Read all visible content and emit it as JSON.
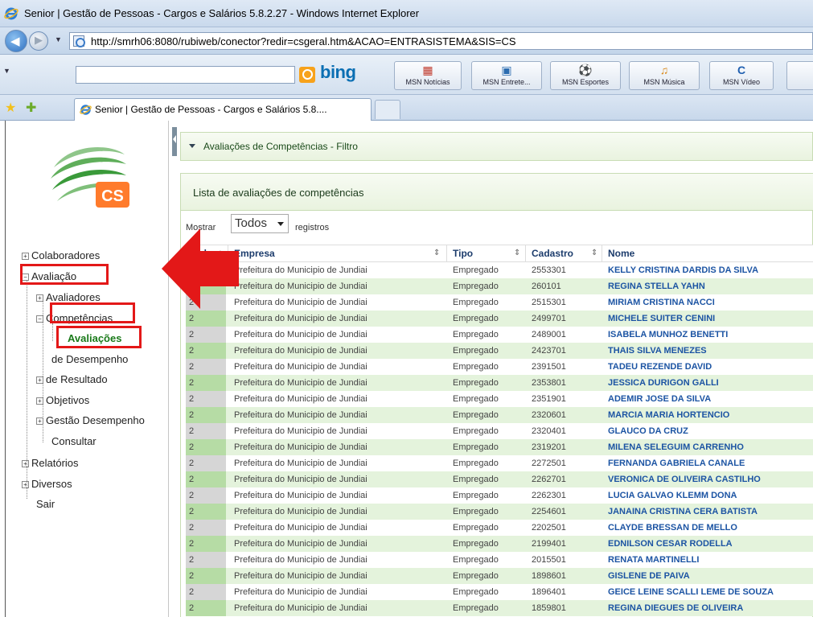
{
  "window": {
    "title": "Senior | Gestão de Pessoas - Cargos e Salários 5.8.2.27 - Windows Internet Explorer",
    "url": "http://smrh06:8080/rubiweb/conector?redir=csgeral.htm&ACAO=ENTRASISTEMA&SIS=CS",
    "search_logo": "bing",
    "links": [
      {
        "label": "MSN Notícias",
        "icon": "news-icon",
        "color": "#c0392b"
      },
      {
        "label": "MSN Entrete...",
        "icon": "entertainment-icon",
        "color": "#2b6cb0"
      },
      {
        "label": "MSN Esportes",
        "icon": "sports-icon",
        "color": "#2e8b57"
      },
      {
        "label": "MSN Música",
        "icon": "music-icon",
        "color": "#d98a1c"
      },
      {
        "label": "MSN Vídeo",
        "icon": "video-icon",
        "color": "#1f5fb0"
      }
    ],
    "tab_title": "Senior | Gestão de Pessoas - Cargos e Salários 5.8...."
  },
  "sidebar": {
    "logo_text": "CS",
    "tree": {
      "colaboradores": "Colaboradores",
      "avaliacao": "Avaliação",
      "avaliadores": "Avaliadores",
      "competencias": "Competências",
      "avaliacoes": "Avaliações",
      "desempenho": "de Desempenho",
      "resultado": "de Resultado",
      "objetivos": "Objetivos",
      "gestao_desempenho": "Gestão Desempenho",
      "consultar": "Consultar",
      "relatorios": "Relatórios",
      "diversos": "Diversos",
      "sair": "Sair"
    },
    "highlight_color": "#e31818"
  },
  "filter_panel": {
    "title": "Avaliações de Competências - Filtro"
  },
  "list": {
    "title": "Lista de avaliações de competências",
    "show_label": "Mostrar",
    "show_value": "Todos",
    "show_suffix": "registros",
    "columns": {
      "ciclo": "Ciclo",
      "empresa": "Empresa",
      "tipo": "Tipo",
      "cadastro": "Cadastro",
      "nome": "Nome"
    },
    "rows": [
      {
        "ciclo": "2",
        "empresa": "Prefeitura do Municipio de Jundiai",
        "tipo": "Empregado",
        "cadastro": "2553301",
        "nome": "KELLY CRISTINA DARDIS DA SILVA"
      },
      {
        "ciclo": "2",
        "empresa": "Prefeitura do Municipio de Jundiai",
        "tipo": "Empregado",
        "cadastro": "260101",
        "nome": "REGINA STELLA YAHN"
      },
      {
        "ciclo": "2",
        "empresa": "Prefeitura do Municipio de Jundiai",
        "tipo": "Empregado",
        "cadastro": "2515301",
        "nome": "MIRIAM CRISTINA NACCI"
      },
      {
        "ciclo": "2",
        "empresa": "Prefeitura do Municipio de Jundiai",
        "tipo": "Empregado",
        "cadastro": "2499701",
        "nome": "MICHELE SUITER CENINI"
      },
      {
        "ciclo": "2",
        "empresa": "Prefeitura do Municipio de Jundiai",
        "tipo": "Empregado",
        "cadastro": "2489001",
        "nome": "ISABELA MUNHOZ BENETTI"
      },
      {
        "ciclo": "2",
        "empresa": "Prefeitura do Municipio de Jundiai",
        "tipo": "Empregado",
        "cadastro": "2423701",
        "nome": "THAIS SILVA MENEZES"
      },
      {
        "ciclo": "2",
        "empresa": "Prefeitura do Municipio de Jundiai",
        "tipo": "Empregado",
        "cadastro": "2391501",
        "nome": "TADEU REZENDE DAVID"
      },
      {
        "ciclo": "2",
        "empresa": "Prefeitura do Municipio de Jundiai",
        "tipo": "Empregado",
        "cadastro": "2353801",
        "nome": "JESSICA DURIGON GALLI"
      },
      {
        "ciclo": "2",
        "empresa": "Prefeitura do Municipio de Jundiai",
        "tipo": "Empregado",
        "cadastro": "2351901",
        "nome": "ADEMIR JOSE DA SILVA"
      },
      {
        "ciclo": "2",
        "empresa": "Prefeitura do Municipio de Jundiai",
        "tipo": "Empregado",
        "cadastro": "2320601",
        "nome": "MARCIA MARIA HORTENCIO"
      },
      {
        "ciclo": "2",
        "empresa": "Prefeitura do Municipio de Jundiai",
        "tipo": "Empregado",
        "cadastro": "2320401",
        "nome": "GLAUCO DA CRUZ"
      },
      {
        "ciclo": "2",
        "empresa": "Prefeitura do Municipio de Jundiai",
        "tipo": "Empregado",
        "cadastro": "2319201",
        "nome": "MILENA SELEGUIM CARRENHO"
      },
      {
        "ciclo": "2",
        "empresa": "Prefeitura do Municipio de Jundiai",
        "tipo": "Empregado",
        "cadastro": "2272501",
        "nome": "FERNANDA GABRIELA CANALE"
      },
      {
        "ciclo": "2",
        "empresa": "Prefeitura do Municipio de Jundiai",
        "tipo": "Empregado",
        "cadastro": "2262701",
        "nome": "VERONICA DE OLIVEIRA CASTILHO"
      },
      {
        "ciclo": "2",
        "empresa": "Prefeitura do Municipio de Jundiai",
        "tipo": "Empregado",
        "cadastro": "2262301",
        "nome": "LUCIA GALVAO KLEMM DONA"
      },
      {
        "ciclo": "2",
        "empresa": "Prefeitura do Municipio de Jundiai",
        "tipo": "Empregado",
        "cadastro": "2254601",
        "nome": "JANAINA CRISTINA CERA BATISTA"
      },
      {
        "ciclo": "2",
        "empresa": "Prefeitura do Municipio de Jundiai",
        "tipo": "Empregado",
        "cadastro": "2202501",
        "nome": "CLAYDE BRESSAN DE MELLO"
      },
      {
        "ciclo": "2",
        "empresa": "Prefeitura do Municipio de Jundiai",
        "tipo": "Empregado",
        "cadastro": "2199401",
        "nome": "EDNILSON CESAR RODELLA"
      },
      {
        "ciclo": "2",
        "empresa": "Prefeitura do Municipio de Jundiai",
        "tipo": "Empregado",
        "cadastro": "2015501",
        "nome": "RENATA MARTINELLI"
      },
      {
        "ciclo": "2",
        "empresa": "Prefeitura do Municipio de Jundiai",
        "tipo": "Empregado",
        "cadastro": "1898601",
        "nome": "GISLENE DE PAIVA"
      },
      {
        "ciclo": "2",
        "empresa": "Prefeitura do Municipio de Jundiai",
        "tipo": "Empregado",
        "cadastro": "1896401",
        "nome": "GEICE LEINE SCALLI LEME DE SOUZA"
      },
      {
        "ciclo": "2",
        "empresa": "Prefeitura do Municipio de Jundiai",
        "tipo": "Empregado",
        "cadastro": "1859801",
        "nome": "REGINA DIEGUES DE OLIVEIRA"
      }
    ]
  }
}
